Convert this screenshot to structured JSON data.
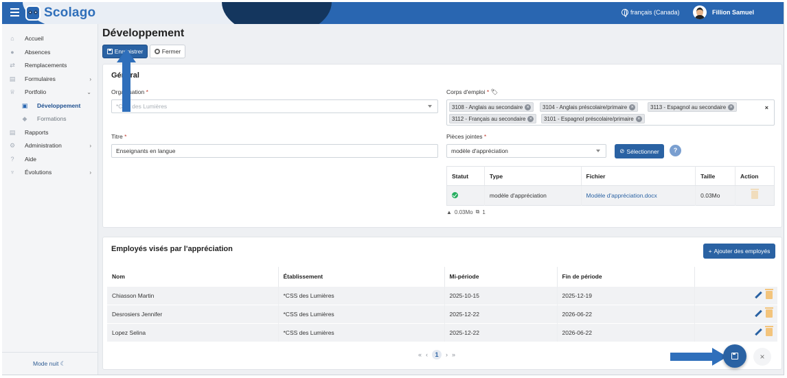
{
  "header": {
    "brand": "Scolago",
    "language": "français (Canada)",
    "user_name": "Fillion Samuel"
  },
  "sidebar": {
    "items": [
      {
        "label": "Accueil",
        "icon": "home-icon"
      },
      {
        "label": "Absences",
        "icon": "person-minus-icon"
      },
      {
        "label": "Remplacements",
        "icon": "swap-icon"
      },
      {
        "label": "Formulaires",
        "icon": "document-icon"
      },
      {
        "label": "Portfolio",
        "icon": "trophy-icon"
      },
      {
        "label": "Développement",
        "icon": "chalkboard-icon"
      },
      {
        "label": "Formations",
        "icon": "graduation-cap-icon"
      },
      {
        "label": "Rapports",
        "icon": "report-icon"
      },
      {
        "label": "Administration",
        "icon": "gear-icon"
      },
      {
        "label": "Aide",
        "icon": "question-icon"
      },
      {
        "label": "Évolutions",
        "icon": "sprout-icon"
      }
    ],
    "night_mode": "Mode nuit ☾"
  },
  "page": {
    "title": "Développement",
    "save_label": "Enregistrer",
    "close_label": "Fermer"
  },
  "general": {
    "section_title": "Général",
    "organisation_label": "Organisation",
    "organisation_value": "*CSS des Lumières",
    "corps_label": "Corps d'emploi",
    "corps_tags": [
      "3108 - Anglais au secondaire",
      "3104 - Anglais préscolaire/primaire",
      "3113 - Espagnol au secondaire",
      "3112 - Français au secondaire",
      "3101 - Espagnol préscolaire/primaire"
    ],
    "titre_label": "Titre",
    "titre_value": "Enseignants en langue",
    "pieces_label": "Pièces jointes",
    "pieces_select_value": "modèle d'appréciation",
    "select_button": "Sélectionner",
    "help": "?",
    "attachments": {
      "headers": [
        "Statut",
        "Type",
        "Fichier",
        "Taille",
        "Action"
      ],
      "rows": [
        {
          "type": "modèle d'appréciation",
          "file": "Modèle d'appréciation.docx",
          "size": "0.03Mo"
        }
      ]
    },
    "summary_size": "0.03Mo",
    "summary_count": "1"
  },
  "employees": {
    "section_title": "Employés visés par l'appréciation",
    "add_button": "Ajouter des employés",
    "headers": [
      "Nom",
      "Établissement",
      "Mi-période",
      "Fin de période"
    ],
    "rows": [
      {
        "nom": "Chiasson Martin",
        "etab": "*CSS des Lumières",
        "mi": "2025-10-15",
        "fin": "2025-12-19"
      },
      {
        "nom": "Desrosiers Jennifer",
        "etab": "*CSS des Lumières",
        "mi": "2025-12-22",
        "fin": "2026-06-22"
      },
      {
        "nom": "Lopez Selina",
        "etab": "*CSS des Lumières",
        "mi": "2025-12-22",
        "fin": "2026-06-22"
      }
    ],
    "pager": {
      "first": "«",
      "prev": "‹",
      "current": "1",
      "next": "›",
      "last": "»"
    }
  },
  "fab": {
    "close": "×"
  },
  "colors": {
    "primary": "#2a62a3",
    "header": "#2966b1",
    "success": "#27ae60",
    "trash": "#f3c47c"
  }
}
